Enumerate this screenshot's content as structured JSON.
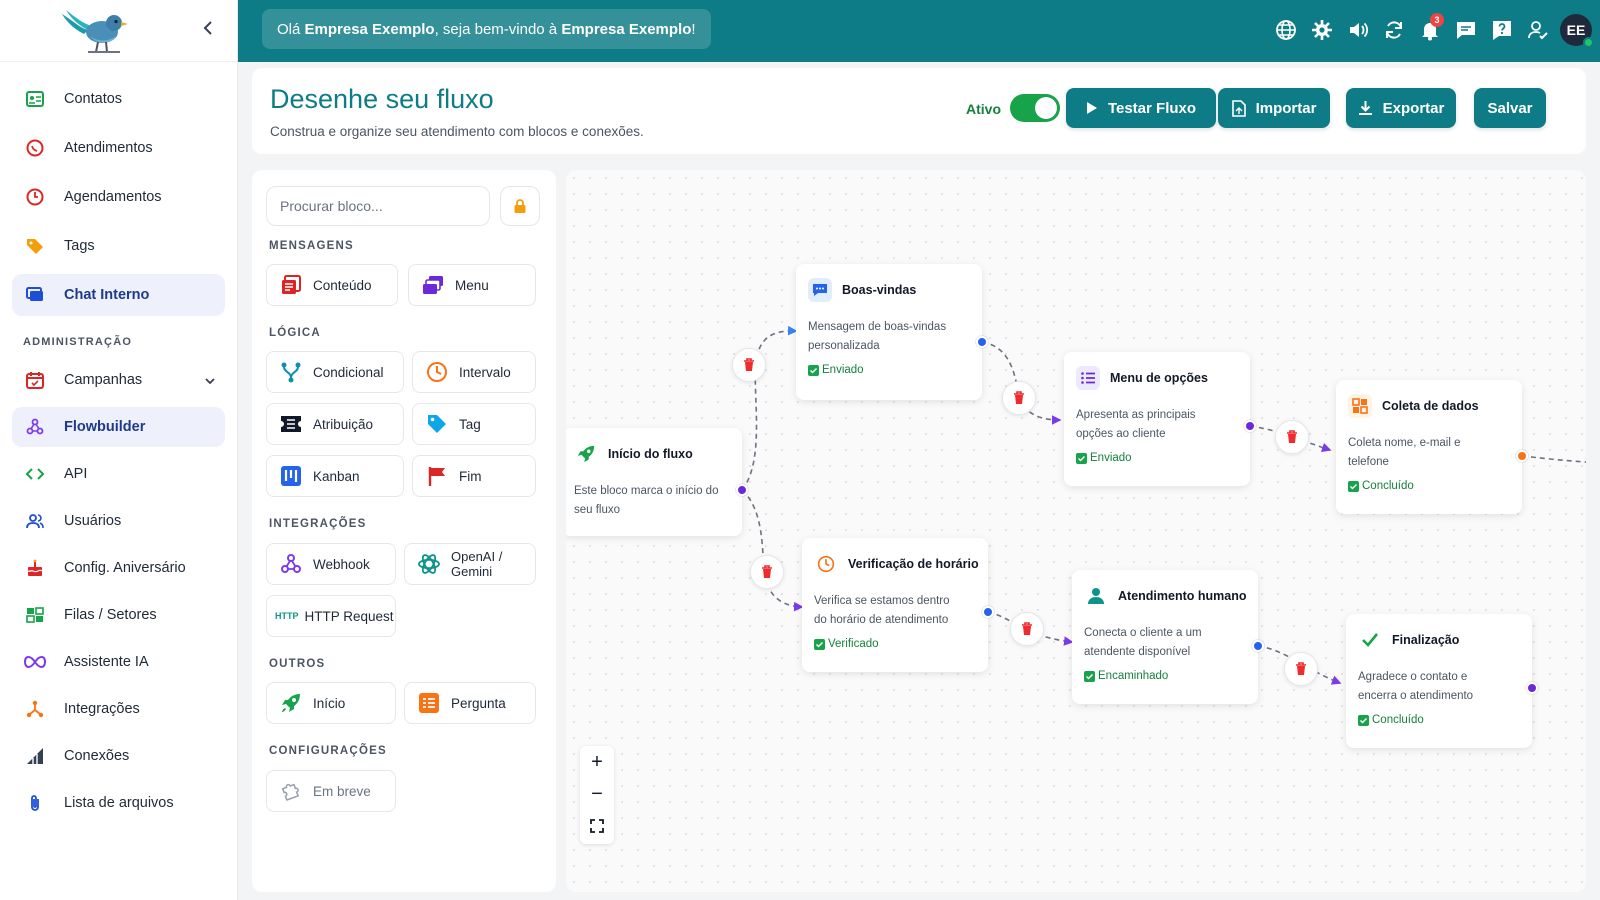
{
  "sidebar": {
    "collapse_icon": "chevron-left-icon",
    "items": [
      {
        "label": "Contatos",
        "icon": "contacts-icon"
      },
      {
        "label": "Atendimentos",
        "icon": "whatsapp-icon"
      },
      {
        "label": "Agendamentos",
        "icon": "clock-icon"
      },
      {
        "label": "Tags",
        "icon": "tag-icon"
      },
      {
        "label": "Chat Interno",
        "icon": "chat-icon",
        "active": true
      }
    ],
    "admin_section": "ADMINISTRAÇÃO",
    "admin_items": [
      {
        "label": "Campanhas",
        "icon": "calendar-icon"
      },
      {
        "label": "Flowbuilder",
        "icon": "webhook-icon",
        "active": true
      },
      {
        "label": "API",
        "icon": "code-icon"
      },
      {
        "label": "Usuários",
        "icon": "users-icon"
      },
      {
        "label": "Config. Aniversário",
        "icon": "cake-icon"
      },
      {
        "label": "Filas / Setores",
        "icon": "queue-icon"
      },
      {
        "label": "Assistente IA",
        "icon": "infinity-icon"
      },
      {
        "label": "Integrações",
        "icon": "integrations-icon"
      },
      {
        "label": "Conexões",
        "icon": "signal-icon"
      },
      {
        "label": "Lista de arquivos",
        "icon": "paperclip-icon"
      }
    ]
  },
  "topbar": {
    "greet_prefix": "Olá ",
    "company": "Empresa Exemplo",
    "greet_mid": ", seja bem-vindo à ",
    "company2": "Empresa Exemplo",
    "greet_suffix": "!",
    "notifications_count": "3",
    "avatar_initials": "EE",
    "icons": [
      "globe-icon",
      "gear-icon",
      "volume-icon",
      "refresh-icon",
      "bell-icon",
      "message-icon",
      "help-icon",
      "user-check-icon"
    ]
  },
  "header": {
    "title": "Desenhe seu fluxo",
    "subtitle": "Construa e organize seu atendimento com blocos e conexões.",
    "active_label": "Ativo",
    "active": true,
    "buttons": {
      "test": "Testar Fluxo",
      "import": "Importar",
      "export": "Exportar",
      "save": "Salvar"
    }
  },
  "blocks": {
    "search_placeholder": "Procurar bloco...",
    "categories": {
      "messages": "MENSAGENS",
      "logic": "LÓGICA",
      "integrations": "INTEGRAÇÕES",
      "others": "OUTROS",
      "settings": "CONFIGURAÇÕES"
    },
    "items": {
      "content": "Conteúdo",
      "menu": "Menu",
      "conditional": "Condicional",
      "interval": "Intervalo",
      "assignment": "Atribuição",
      "tag": "Tag",
      "kanban": "Kanban",
      "end": "Fim",
      "webhook": "Webhook",
      "openai": "OpenAI /\nGemini",
      "openai_l1": "OpenAI /",
      "openai_l2": "Gemini",
      "http": "HTTP Request",
      "http_tag": "HTTP",
      "start": "Início",
      "question": "Pergunta",
      "soon": "Em breve"
    }
  },
  "flow": {
    "nodes": {
      "start": {
        "title": "Início do fluxo",
        "desc1": "Este bloco marca o início do",
        "desc2": "seu fluxo"
      },
      "welcome": {
        "title": "Boas-vindas",
        "desc1": "Mensagem de boas-vindas",
        "desc2": "personalizada",
        "status": "Enviado"
      },
      "menu": {
        "title": "Menu de opções",
        "desc1": "Apresenta as principais",
        "desc2": "opções ao cliente",
        "status": "Enviado"
      },
      "collect": {
        "title": "Coleta de dados",
        "desc1": "Coleta nome, e-mail e",
        "desc2": "telefone",
        "status": "Concluído"
      },
      "hours": {
        "title": "Verificação de horário",
        "desc1": "Verifica se estamos dentro",
        "desc2": "do horário de atendimento",
        "status": "Verificado"
      },
      "human": {
        "title": "Atendimento humano",
        "desc1": "Conecta o cliente a um",
        "desc2": "atendente disponível",
        "status": "Encaminhado"
      },
      "finish": {
        "title": "Finalização",
        "desc1": "Agradece o contato e",
        "desc2": "encerra o atendimento",
        "status": "Concluído"
      }
    },
    "zoom": {
      "in": "+",
      "out": "−"
    }
  },
  "colors": {
    "brand": "#0e7c86",
    "success": "#16a34a",
    "danger": "#ef2b2d",
    "purple": "#6d28d9",
    "blue": "#2563eb",
    "orange": "#f97316"
  }
}
